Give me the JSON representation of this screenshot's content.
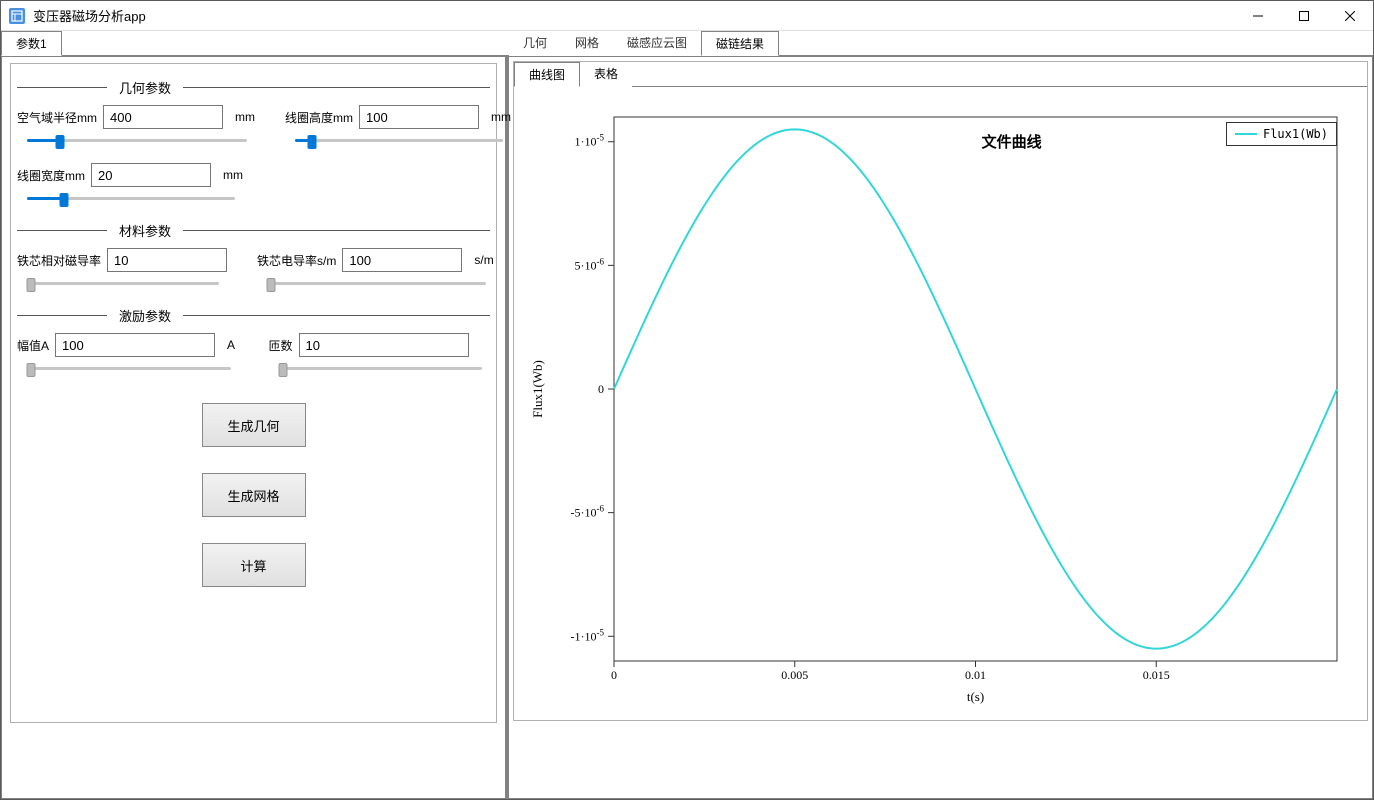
{
  "window": {
    "title": "变压器磁场分析app"
  },
  "left_tabs": [
    "参数1"
  ],
  "right_tabs": [
    "几何",
    "网格",
    "磁感应云图",
    "磁链结果"
  ],
  "right_tab_active": 3,
  "sections": {
    "geom": {
      "title": "几何参数"
    },
    "material": {
      "title": "材料参数"
    },
    "excite": {
      "title": "激励参数"
    }
  },
  "params": {
    "air_radius": {
      "label": "空气域半径mm",
      "value": "400",
      "unit": "mm",
      "slider_pct": 15,
      "filled": true
    },
    "coil_height": {
      "label": "线圈高度mm",
      "value": "100",
      "unit": "mm",
      "slider_pct": 8,
      "filled": true
    },
    "coil_width": {
      "label": "线圈宽度mm",
      "value": "20",
      "unit": "mm",
      "slider_pct": 18,
      "filled": true
    },
    "core_perm": {
      "label": "铁芯相对磁导率",
      "value": "10",
      "unit": "",
      "slider_pct": 2,
      "filled": false
    },
    "core_cond": {
      "label": "铁芯电导率s/m",
      "value": "100",
      "unit": "s/m",
      "slider_pct": 2,
      "filled": false
    },
    "amplitude": {
      "label": "幅值A",
      "value": "100",
      "unit": "A",
      "slider_pct": 2,
      "filled": false
    },
    "turns": {
      "label": "匝数",
      "value": "10",
      "unit": "",
      "slider_pct": 2,
      "filled": false
    }
  },
  "buttons": {
    "gen_geom": "生成几何",
    "gen_mesh": "生成网格",
    "compute": "计算"
  },
  "sub_tabs": [
    "曲线图",
    "表格"
  ],
  "sub_tab_active": 0,
  "chart_data": {
    "type": "line",
    "title": "文件曲线",
    "xlabel": "t(s)",
    "ylabel": "Flux1(Wb)",
    "xlim": [
      0,
      0.02
    ],
    "ylim": [
      -1.1e-05,
      1.1e-05
    ],
    "x_ticks": [
      0,
      0.005,
      0.01,
      0.015
    ],
    "x_tick_labels": [
      "0",
      "0.005",
      "0.01",
      "0.015"
    ],
    "y_ticks": [
      -1e-05,
      -5e-06,
      0,
      5e-06,
      1e-05
    ],
    "y_tick_labels": [
      "-1·10⁻⁵",
      "-5·10⁻⁶",
      "0",
      "5·10⁻⁶",
      "1·10⁻⁵"
    ],
    "series": [
      {
        "name": "Flux1(Wb)",
        "color": "#33d6d6",
        "x": [
          0,
          0.001,
          0.002,
          0.003,
          0.004,
          0.005,
          0.006,
          0.007,
          0.008,
          0.009,
          0.01,
          0.011,
          0.012,
          0.013,
          0.014,
          0.015,
          0.016,
          0.017,
          0.018,
          0.019,
          0.02
        ],
        "y": [
          0,
          3.25e-06,
          6.18e-06,
          8.5e-06,
          1e-05,
          1.05e-05,
          1e-05,
          8.5e-06,
          6.18e-06,
          3.25e-06,
          0,
          -3.25e-06,
          -6.18e-06,
          -8.5e-06,
          -1e-05,
          -1.05e-05,
          -1e-05,
          -8.5e-06,
          -6.18e-06,
          -3.25e-06,
          0
        ]
      }
    ]
  }
}
